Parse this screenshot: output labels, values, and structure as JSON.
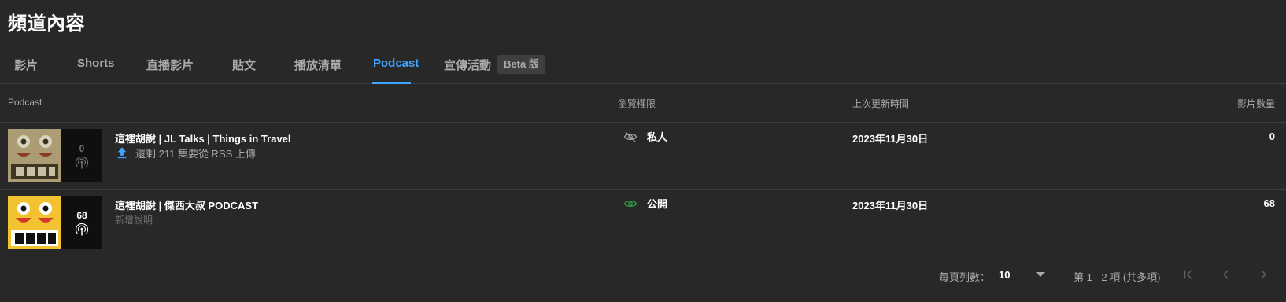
{
  "page": {
    "title": "頻道內容"
  },
  "tabs": [
    {
      "label": "影片"
    },
    {
      "label": "Shorts"
    },
    {
      "label": "直播影片"
    },
    {
      "label": "貼文"
    },
    {
      "label": "播放清單"
    },
    {
      "label": "Podcast"
    },
    {
      "label": "宣傳活動"
    }
  ],
  "active_tab": "Podcast",
  "beta_badge": "Beta 版",
  "table": {
    "headers": {
      "podcast": "Podcast",
      "visibility": "瀏覽權限",
      "updated": "上次更新時間",
      "video_count": "影片數量"
    },
    "rows": [
      {
        "count": "0",
        "title": "這裡胡說 | JL Talks | Things in Travel",
        "status": "還剩 211 集要從 RSS 上傳",
        "visibility": "私人",
        "updated": "2023年11月30日",
        "video_count": "0"
      },
      {
        "count": "68",
        "title": "這裡胡說 | 傑西大叔 PODCAST",
        "subtitle": "新增說明",
        "visibility": "公開",
        "updated": "2023年11月30日",
        "video_count": "68"
      }
    ]
  },
  "pagination": {
    "rows_per_page_label": "每頁列數：",
    "rows_per_page": "10",
    "range": "第 1 - 2 項 (共多項)"
  },
  "colors": {
    "accent": "#3ea6ff",
    "public_eye": "#2ba640",
    "background": "#282828"
  }
}
